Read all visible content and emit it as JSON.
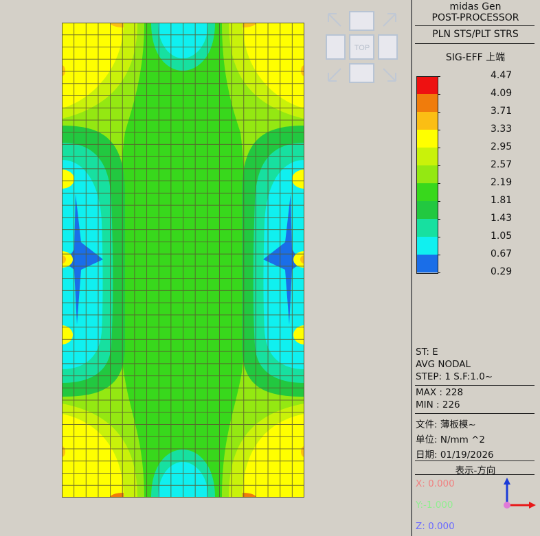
{
  "header": {
    "app": "midas Gen",
    "mode": "POST-PROCESSOR",
    "result_type": "PLN STS/PLT STRS",
    "component": "SIG-EFF 上端"
  },
  "legend": {
    "values": [
      "4.47",
      "4.09",
      "3.71",
      "3.33",
      "2.95",
      "2.57",
      "2.19",
      "1.81",
      "1.43",
      "1.05",
      "0.67",
      "0.29"
    ],
    "colors": [
      "#ee1111",
      "#f07c0c",
      "#fbbe14",
      "#ffff00",
      "#c9f20a",
      "#94e812",
      "#38d81c",
      "#22c840",
      "#17e0a0",
      "#10f0f0",
      "#1a6ee8"
    ]
  },
  "nav_cube": {
    "label": "TOP"
  },
  "info": {
    "st": "ST: E",
    "avg": "AVG NODAL",
    "step": "STEP: 1 S.F:1.0~",
    "max": "MAX : 228",
    "min": "MIN : 226",
    "file": "文件: 薄板模~",
    "unit": "单位: N/mm ^2",
    "date": "日期: 01/19/2026"
  },
  "view_direction": {
    "title": "表示-方向",
    "x": "X: 0.000",
    "y": "Y:-1.000",
    "z": "Z: 0.000",
    "x_color": "#f08080",
    "y_color": "#90ee90",
    "z_color": "#6a6aff"
  }
}
